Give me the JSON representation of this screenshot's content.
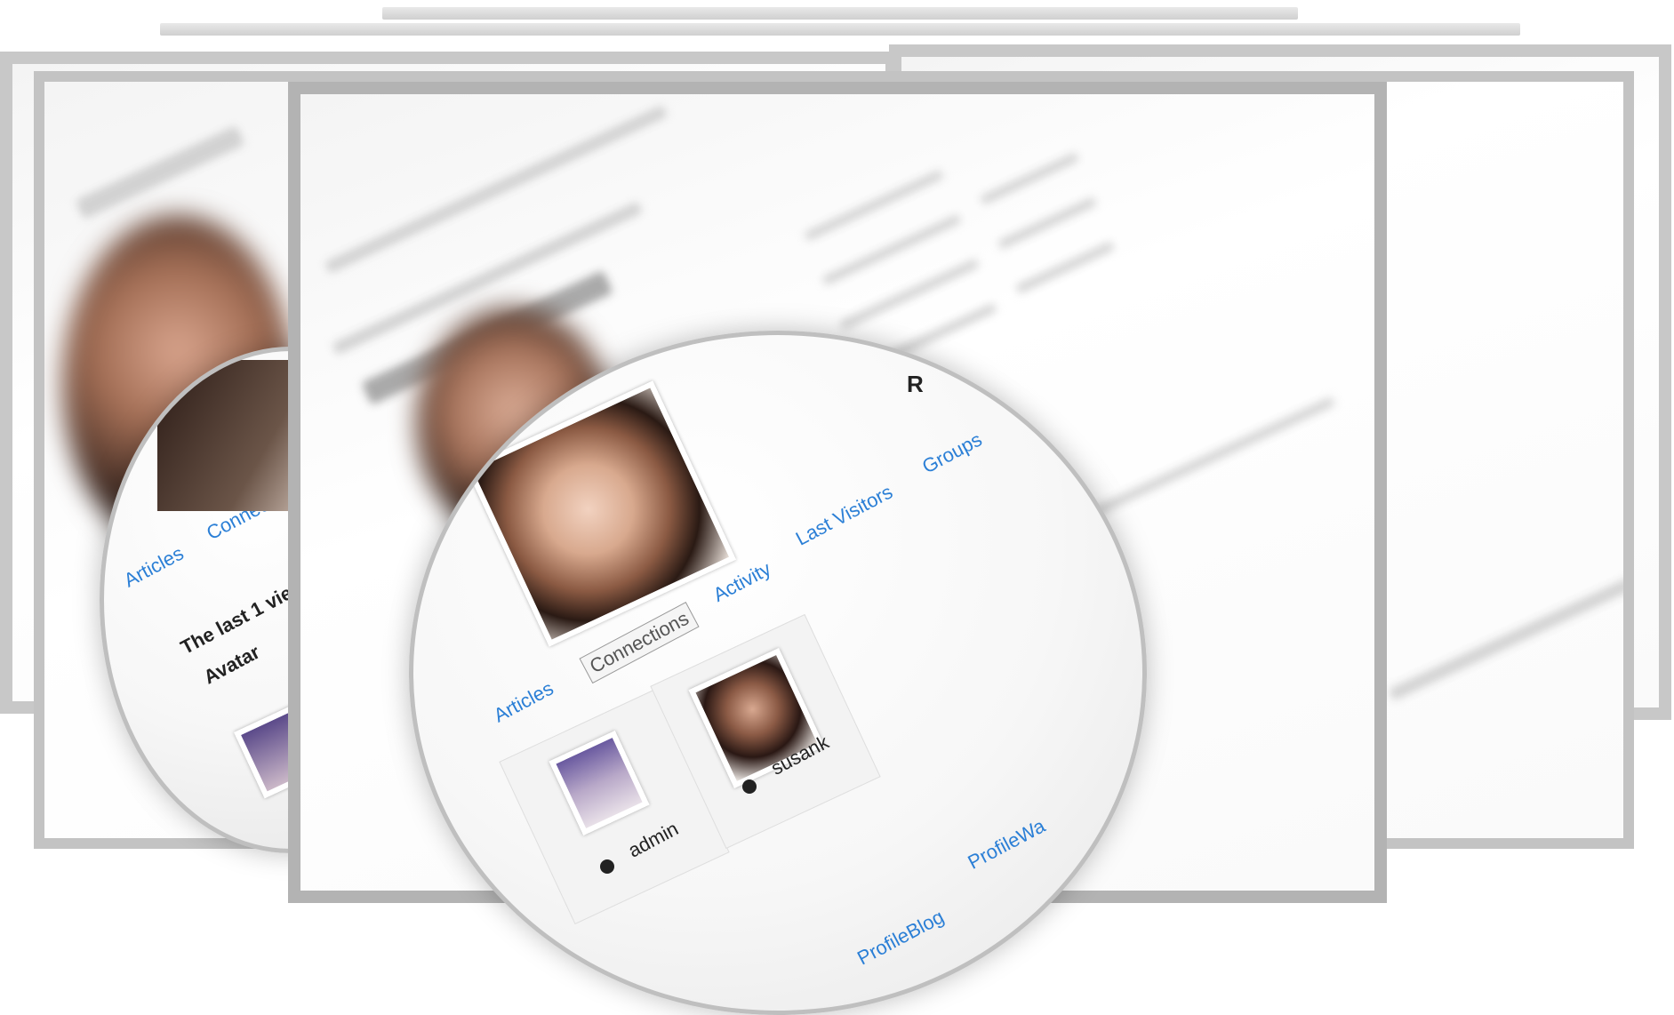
{
  "lens": {
    "tabs": [
      "Articles",
      "Connections",
      "Activity",
      "Last Visitors",
      "Groups"
    ],
    "corner_label": "R",
    "users": [
      "admin",
      "susank"
    ],
    "bottom_links": [
      "ProfileBlog",
      "ProfileWa"
    ]
  },
  "left_lens": {
    "tabs": [
      "Articles",
      "Connections"
    ],
    "heading": "The last 1 vie",
    "column": "Avatar"
  },
  "colors": {
    "link": "#2b7fd6",
    "frame": "#bdbdbd"
  }
}
